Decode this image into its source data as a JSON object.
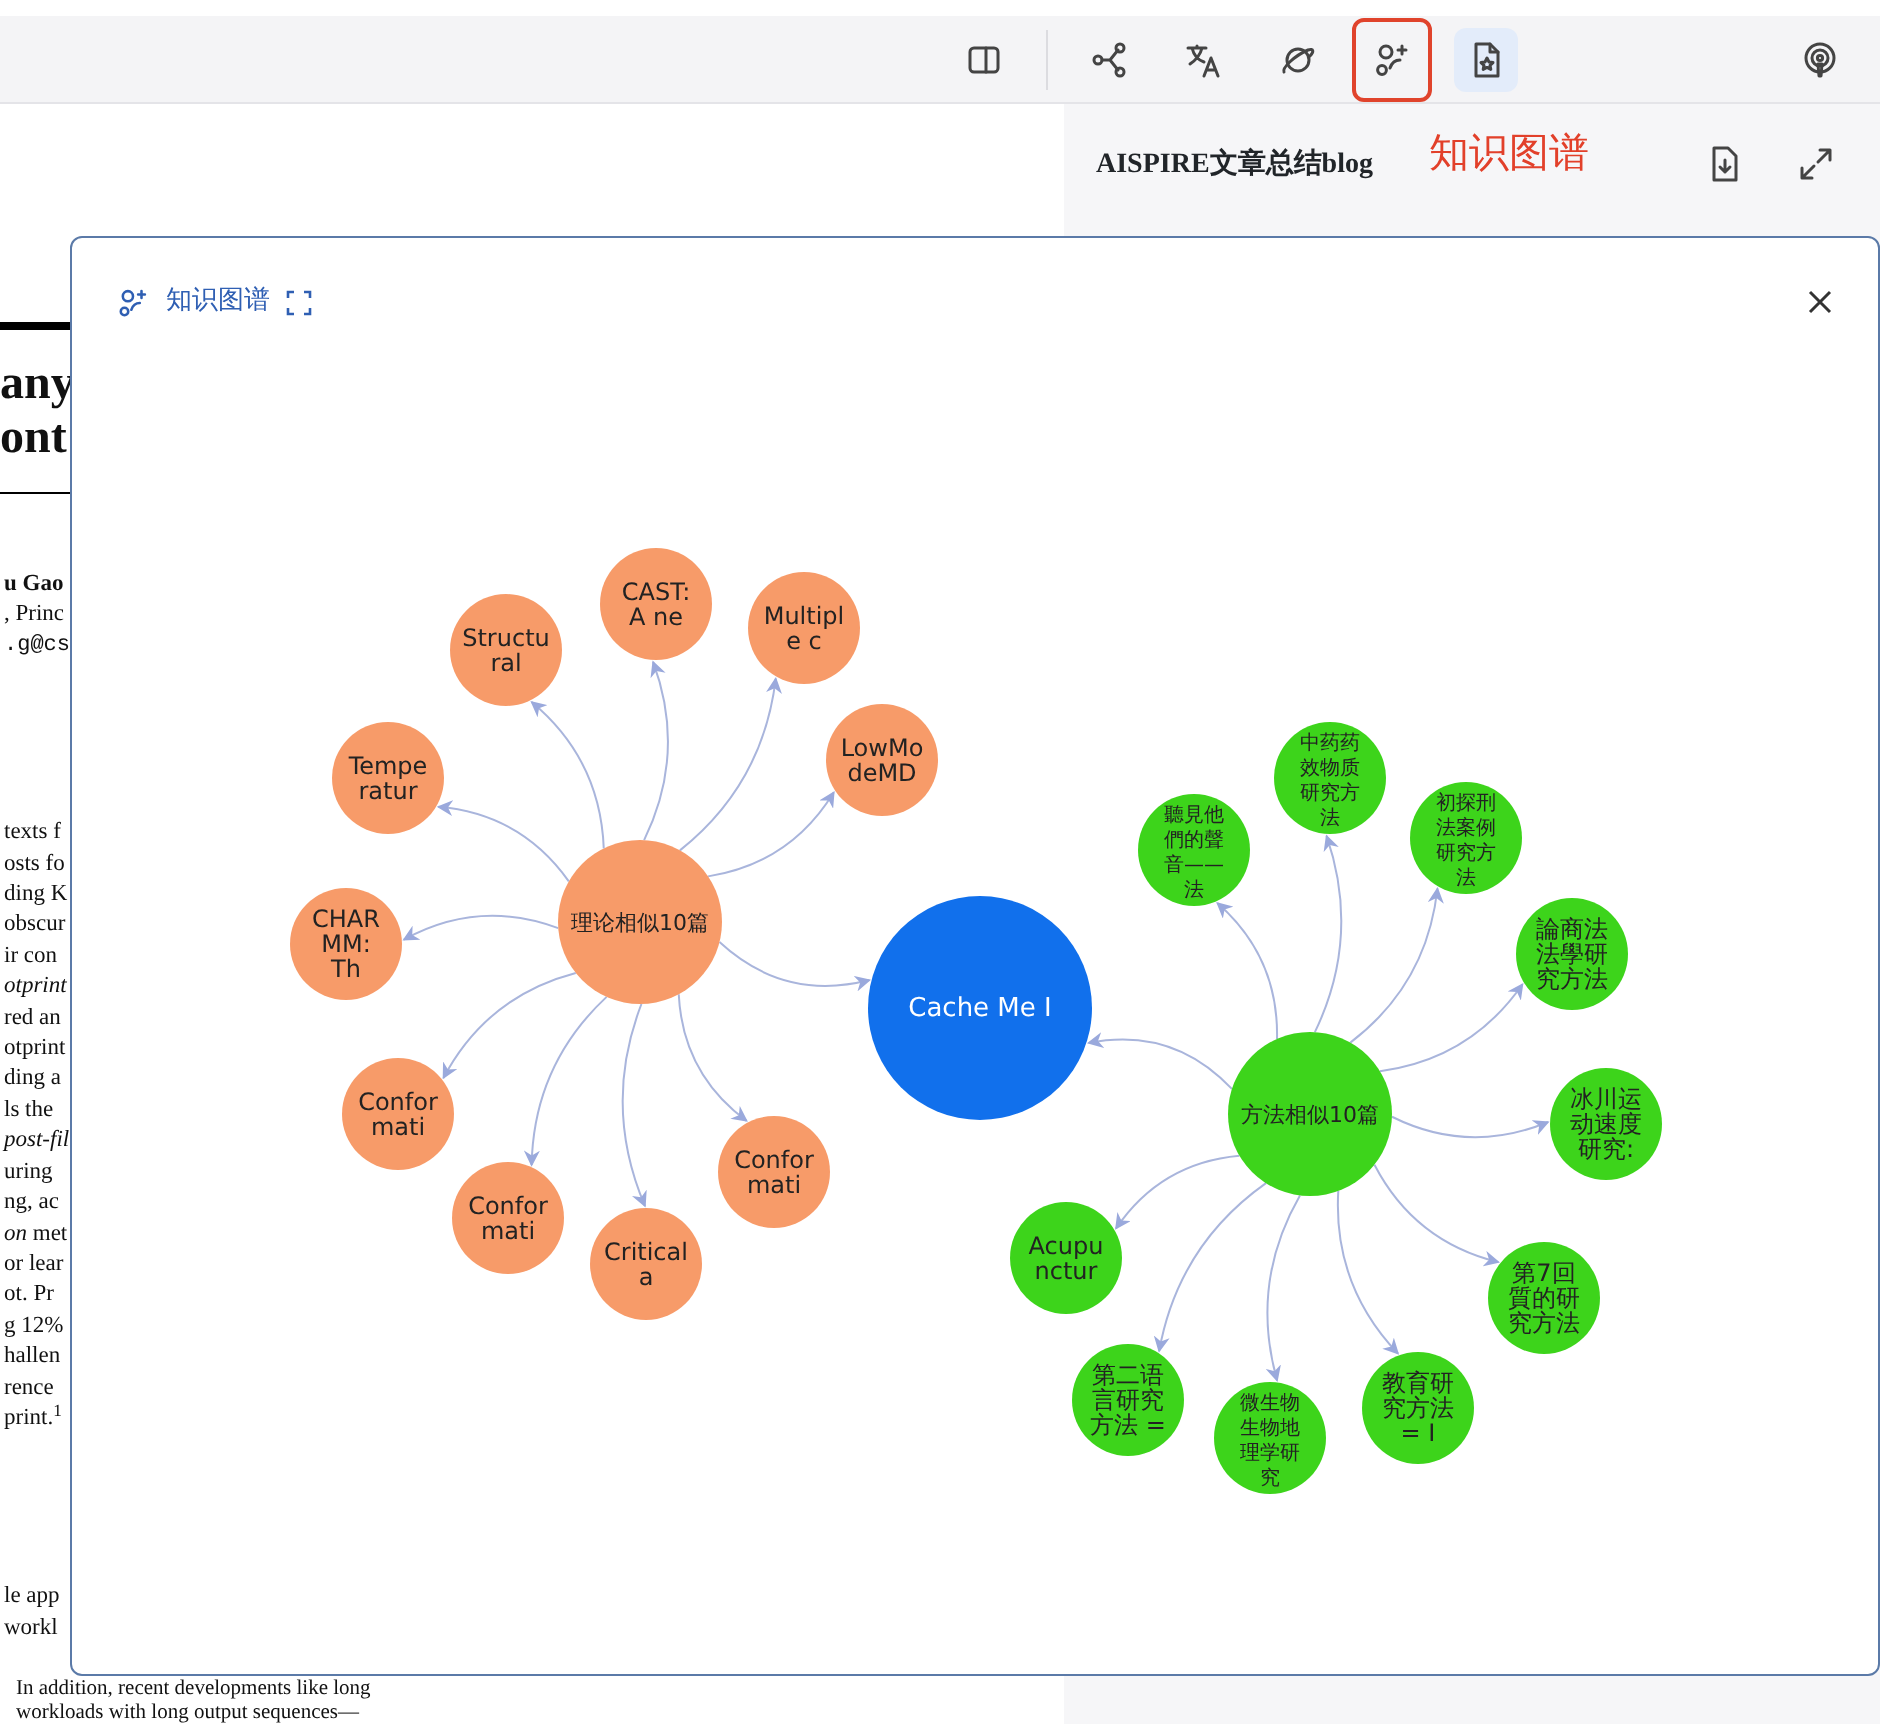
{
  "toolbar": {
    "buttons": [
      {
        "kind": "sidebar",
        "selected": false,
        "highlighted": false
      },
      {
        "kind": "share",
        "selected": false,
        "highlighted": false
      },
      {
        "kind": "translate",
        "selected": false,
        "highlighted": false
      },
      {
        "kind": "planet",
        "selected": false,
        "highlighted": false
      },
      {
        "kind": "graph",
        "selected": false,
        "highlighted": true
      },
      {
        "kind": "doc-star",
        "selected": true,
        "highlighted": false
      },
      {
        "kind": "podcast",
        "selected": false,
        "highlighted": false
      }
    ],
    "annotation": "知识图谱"
  },
  "side_panel": {
    "title": "AISPIRE文章总结blog",
    "buttons": [
      {
        "kind": "download"
      },
      {
        "kind": "expand"
      }
    ]
  },
  "document": {
    "title_lines": [
      "any",
      "ont"
    ],
    "author_lines": [
      {
        "text": "u Gao",
        "kind": "bold"
      },
      {
        "text": ", Princ",
        "kind": "plain"
      },
      {
        "text": ".g@cs",
        "kind": "mono"
      }
    ],
    "body_lines": [
      "texts f",
      "osts fo",
      "ding K",
      "obscur",
      "ir con",
      "*otprint*",
      "red an",
      "otprint",
      "ding a",
      "ls the",
      "*post-fil*",
      "uring",
      "ng, ac",
      "*on* met",
      "or lear",
      "ot. Pr",
      "g 12%",
      "hallen",
      "rence",
      "print.$^{1}$"
    ],
    "bottom_lines": [
      "le app",
      "workl",
      "In addition, recent developments like long",
      "workloads with long output sequences—"
    ]
  },
  "dialog": {
    "title": "知识图谱",
    "graph": {
      "lines": [
        "Cache Me I"
      ],
      "color": "#1170ec",
      "clusters": [
        {
          "lines": [
            "理论相似10篇"
          ],
          "color": "#f79b69",
          "children": [
            {
              "lines": [
                "Structu",
                "ral"
              ],
              "color": "#f79b69"
            },
            {
              "lines": [
                "CAST:",
                "A ne"
              ],
              "color": "#f79b69"
            },
            {
              "lines": [
                "Multipl",
                "e c"
              ],
              "color": "#f79b69"
            },
            {
              "lines": [
                "LowMo",
                "deMD"
              ],
              "color": "#f79b69"
            },
            {
              "lines": [
                "Tempe",
                "ratur"
              ],
              "color": "#f79b69"
            },
            {
              "lines": [
                "CHAR",
                "MM:",
                "Th"
              ],
              "color": "#f79b69"
            },
            {
              "lines": [
                "Confor",
                "mati"
              ],
              "color": "#f79b69"
            },
            {
              "lines": [
                "Confor",
                "mati"
              ],
              "color": "#f79b69"
            },
            {
              "lines": [
                "Critical",
                "a"
              ],
              "color": "#f79b69"
            },
            {
              "lines": [
                "Confor",
                "mati"
              ],
              "color": "#f79b69"
            }
          ]
        },
        {
          "lines": [
            "方法相似10篇"
          ],
          "color": "#3dd41b",
          "children": [
            {
              "lines": [
                "聽見他",
                "們的聲",
                "音——",
                "法"
              ],
              "color": "#3dd41b"
            },
            {
              "lines": [
                "中药药",
                "效物质",
                "研究方",
                "法"
              ],
              "color": "#3dd41b"
            },
            {
              "lines": [
                "初探刑",
                "法案例",
                "研究方",
                "法"
              ],
              "color": "#3dd41b"
            },
            {
              "lines": [
                "論商法",
                "法學研",
                "究方法"
              ],
              "color": "#3dd41b"
            },
            {
              "lines": [
                "冰川运",
                "动速度",
                "研究:"
              ],
              "color": "#3dd41b"
            },
            {
              "lines": [
                "第7回",
                "質的研",
                "究方法"
              ],
              "color": "#3dd41b"
            },
            {
              "lines": [
                "教育研",
                "究方法",
                "= I"
              ],
              "color": "#3dd41b"
            },
            {
              "lines": [
                "微生物",
                "生物地",
                "理学研",
                "究"
              ],
              "color": "#3dd41b"
            },
            {
              "lines": [
                "第二语",
                "言研究",
                "方法 ="
              ],
              "color": "#3dd41b"
            },
            {
              "lines": [
                "Acupu",
                "nctur"
              ],
              "color": "#3dd41b"
            }
          ]
        }
      ]
    }
  }
}
